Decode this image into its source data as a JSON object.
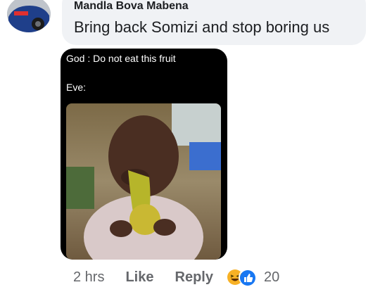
{
  "comment": {
    "author": "Mandla Bova Mabena",
    "text": "Bring back Somizi and stop boring us"
  },
  "meme": {
    "line1": "God : Do not eat this fruit",
    "line2": "Eve:"
  },
  "actions": {
    "time": "2 hrs",
    "like_label": "Like",
    "reply_label": "Reply",
    "reaction_count": "20",
    "reaction_icons": [
      "haha-emoji-icon",
      "like-reaction-icon"
    ]
  },
  "colors": {
    "bubble": "#f0f2f5",
    "meta_text": "#65676b",
    "like_blue": "#1877f2",
    "haha_yellow": "#f7b125"
  }
}
